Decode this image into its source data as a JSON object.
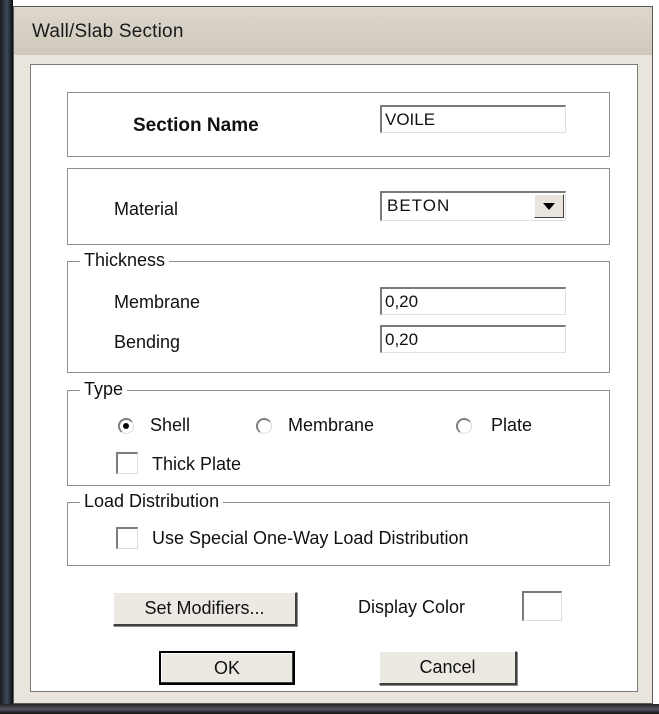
{
  "window": {
    "title": "Wall/Slab Section"
  },
  "section": {
    "label": "Section Name",
    "value": "VOILE"
  },
  "material": {
    "label": "Material",
    "selected": "BETON"
  },
  "thickness": {
    "legend": "Thickness",
    "membrane_label": "Membrane",
    "membrane_value": "0,20",
    "bending_label": "Bending",
    "bending_value": "0,20"
  },
  "type": {
    "legend": "Type",
    "options": [
      {
        "label": "Shell",
        "selected": true
      },
      {
        "label": "Membrane",
        "selected": false
      },
      {
        "label": "Plate",
        "selected": false
      }
    ],
    "thick_plate_label": "Thick Plate",
    "thick_plate_checked": false
  },
  "load_distribution": {
    "legend": "Load Distribution",
    "option_label": "Use Special One-Way Load Distribution",
    "checked": false
  },
  "buttons": {
    "set_modifiers": "Set Modifiers...",
    "display_color_label": "Display Color",
    "display_color": "#ffffff",
    "ok": "OK",
    "cancel": "Cancel"
  }
}
